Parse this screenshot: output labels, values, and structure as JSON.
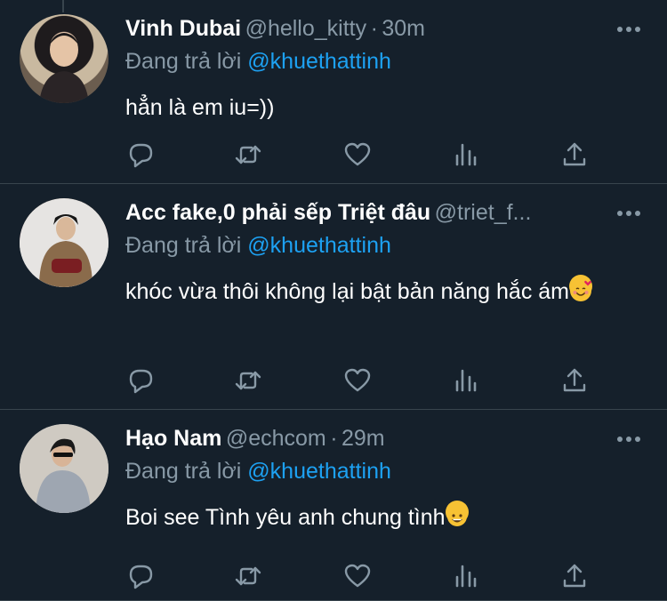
{
  "replying_label": "Đang trả lời",
  "tweets": [
    {
      "name": "Vinh Dubai",
      "handle": "@hello_kitty",
      "separator": "·",
      "time": "30m",
      "replying_to": "@khuethattinh",
      "text": "hẳn là em iu=))",
      "emoji": ""
    },
    {
      "name": "Acc fake,0 phải sếp Triệt đâu",
      "handle": "@triet_f...",
      "separator": "",
      "time": "",
      "replying_to": "@khuethattinh",
      "text": "khóc vừa thôi không lại bật bản năng hắc ám",
      "emoji": "smiling-face-with-hearts"
    },
    {
      "name": "Hạo Nam",
      "handle": "@echcom",
      "separator": "·",
      "time": "29m",
      "replying_to": "@khuethattinh",
      "text": "Boi see Tình yêu anh chung tình",
      "emoji": "grinning-cat"
    }
  ],
  "colors": {
    "background": "#15202b",
    "divider": "#38444d",
    "secondary_text": "#8899a6",
    "mention": "#1da1f2"
  },
  "icons": [
    "reply-icon",
    "retweet-icon",
    "like-icon",
    "analytics-icon",
    "share-icon",
    "more-icon"
  ]
}
